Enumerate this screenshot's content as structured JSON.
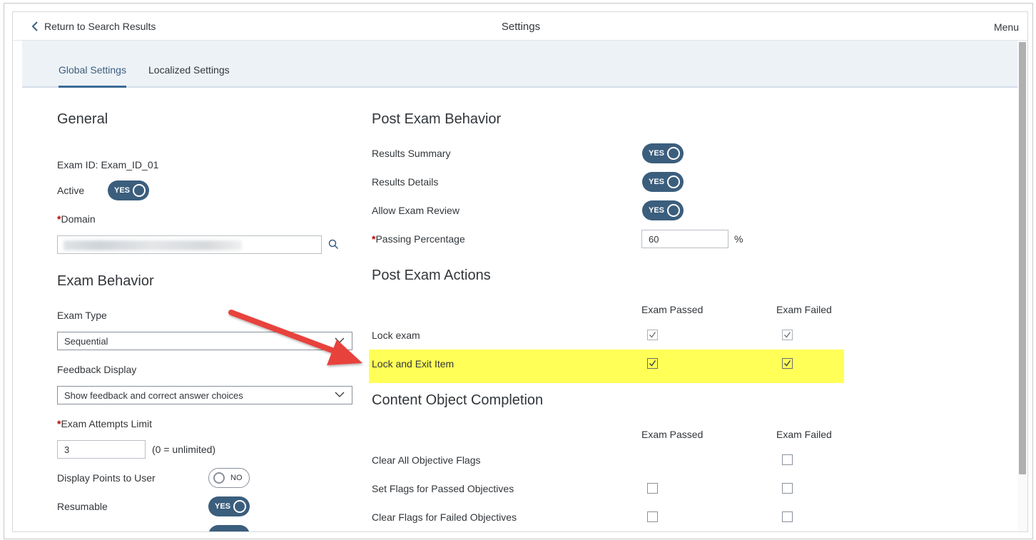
{
  "header": {
    "back_label": "Return to Search Results",
    "title": "Settings",
    "menu_label": "Menu"
  },
  "tabs": [
    {
      "label": "Global Settings",
      "active": true
    },
    {
      "label": "Localized Settings",
      "active": false
    }
  ],
  "general": {
    "title": "General",
    "exam_id": "Exam ID: Exam_ID_01",
    "active_label": "Active",
    "active_toggle": "YES",
    "domain_label": "Domain",
    "domain_value_redacted": true
  },
  "exam_behavior": {
    "title": "Exam Behavior",
    "exam_type_label": "Exam Type",
    "exam_type_value": "Sequential",
    "feedback_label": "Feedback Display",
    "feedback_value": "Show feedback and correct answer choices",
    "attempts_label": "Exam Attempts Limit",
    "attempts_value": "3",
    "attempts_hint": "(0 = unlimited)",
    "points_label": "Display Points to User",
    "points_toggle": "NO",
    "resumable_label": "Resumable",
    "resumable_toggle": "YES"
  },
  "post_exam_behavior": {
    "title": "Post Exam Behavior",
    "results_summary_label": "Results Summary",
    "results_summary_toggle": "YES",
    "results_details_label": "Results Details",
    "results_details_toggle": "YES",
    "allow_review_label": "Allow Exam Review",
    "allow_review_toggle": "YES",
    "passing_label": "Passing Percentage",
    "passing_value": "60",
    "passing_unit": "%"
  },
  "post_exam_actions": {
    "title": "Post Exam Actions",
    "col_passed": "Exam Passed",
    "col_failed": "Exam Failed",
    "rows": [
      {
        "label": "Lock exam",
        "passed": true,
        "failed": true
      },
      {
        "label": "Lock and Exit Item",
        "passed": true,
        "failed": true
      }
    ]
  },
  "content_object_completion": {
    "title": "Content Object Completion",
    "col_passed": "Exam Passed",
    "col_failed": "Exam Failed",
    "rows": [
      {
        "label": "Clear All Objective Flags",
        "passed": null,
        "failed": false
      },
      {
        "label": "Set Flags for Passed Objectives",
        "passed": false,
        "failed": false
      },
      {
        "label": "Clear Flags for Failed Objectives",
        "passed": false,
        "failed": false
      }
    ]
  },
  "colors": {
    "toggle_on": "#3b5e7d",
    "highlight": "#ffff57",
    "arrow": "#e8423c",
    "required": "#bb0000"
  }
}
